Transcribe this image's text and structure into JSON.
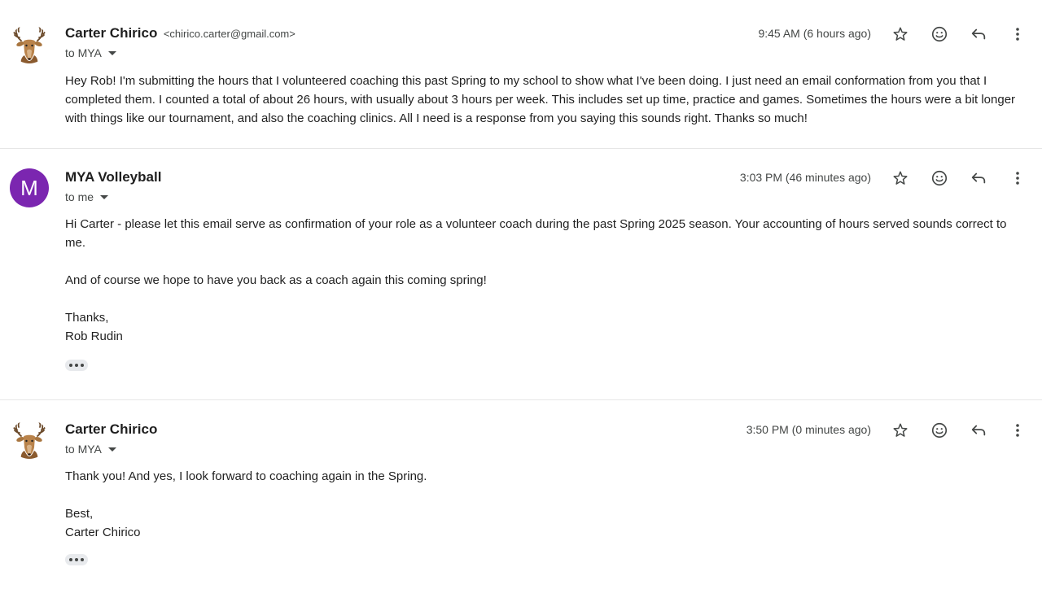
{
  "messages": [
    {
      "sender_name": "Carter Chirico",
      "sender_email": "<chirico.carter@gmail.com>",
      "avatar_icon": "deer-icon",
      "to_label": "to MYA",
      "time": "9:45 AM (6 hours ago)",
      "body": [
        "Hey Rob! I'm submitting the hours that I volunteered coaching this past Spring to my school to show what I've been doing. I just need an email conformation from you that I completed them. I counted a total of about 26 hours, with usually about 3 hours per week. This includes set up time, practice and games. Sometimes the hours were a bit longer with things like our tournament, and also the coaching clinics. All I need is a response from you saying this sounds right. Thanks so much!"
      ]
    },
    {
      "sender_name": "MYA Volleyball",
      "avatar_letter": "M",
      "avatar_color": "#7b26b0",
      "to_label": "to me",
      "time": "3:03 PM (46 minutes ago)",
      "body": [
        "Hi Carter - please let this email serve as confirmation of your role as a volunteer coach during the past Spring 2025 season. Your accounting of hours served sounds correct to me.",
        "And of course we hope to have you back as a coach again this coming spring!",
        "Thanks,",
        "Rob Rudin"
      ]
    },
    {
      "sender_name": "Carter Chirico",
      "avatar_icon": "deer-icon",
      "to_label": "to MYA",
      "time": "3:50 PM (0 minutes ago)",
      "body": [
        "Thank you! And yes, I look forward to coaching again in the Spring.",
        "Best,",
        "Carter Chirico"
      ]
    }
  ],
  "actions": [
    "star-icon",
    "emoji-icon",
    "reply-icon",
    "more-vert-icon"
  ],
  "colors": {
    "avatar_purple": "#7b26b0",
    "text_primary": "#1f1f1f",
    "text_secondary": "#444746",
    "divider": "#e6e6e6"
  }
}
